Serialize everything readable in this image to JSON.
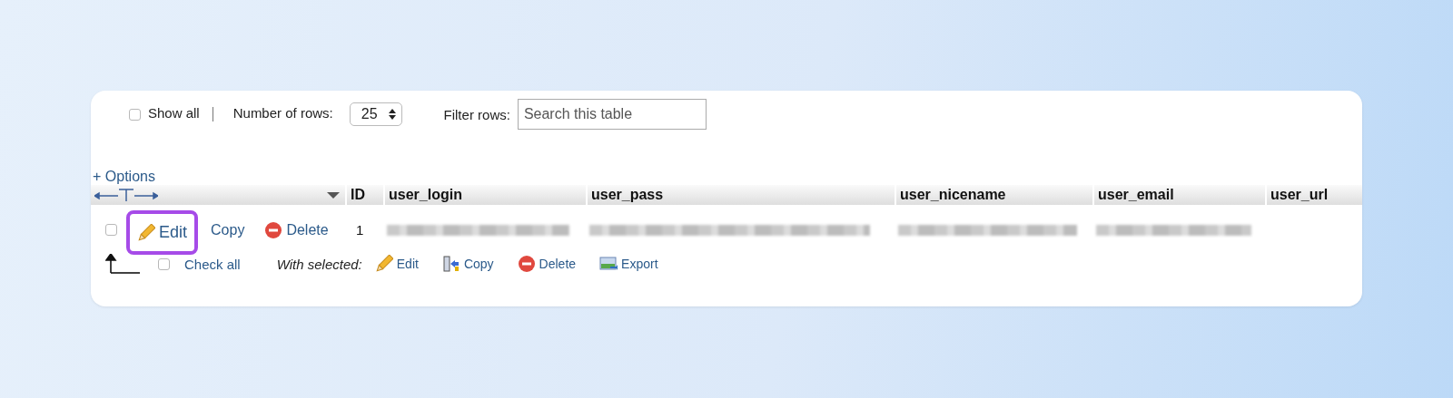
{
  "toolbar": {
    "show_all": {
      "label": "Show all",
      "checked": false
    },
    "rows": {
      "label": "Number of rows:",
      "value": "25"
    },
    "filter": {
      "label": "Filter rows:",
      "placeholder": "Search this table"
    }
  },
  "options_link": "+ Options",
  "table": {
    "columns": [
      {
        "label": "ID"
      },
      {
        "label": "user_login"
      },
      {
        "label": "user_pass"
      },
      {
        "label": "user_nicename"
      },
      {
        "label": "user_email"
      },
      {
        "label": "user_url"
      }
    ],
    "rows": [
      {
        "checked": false,
        "actions": [
          {
            "kind": "edit",
            "label": "Edit",
            "highlighted": true
          },
          {
            "kind": "copy",
            "label": "Copy",
            "highlighted": false
          },
          {
            "kind": "delete",
            "label": "Delete",
            "highlighted": false
          }
        ],
        "cells": [
          {
            "kind": "text",
            "text": "1"
          },
          {
            "kind": "redacted"
          },
          {
            "kind": "redacted"
          },
          {
            "kind": "redacted"
          },
          {
            "kind": "redacted"
          },
          {
            "kind": "blank"
          }
        ]
      }
    ]
  },
  "footer": {
    "check_all": {
      "label": "Check all",
      "checked": false
    },
    "with_selected": "With selected:",
    "actions": [
      {
        "kind": "edit",
        "label": "Edit"
      },
      {
        "kind": "copy",
        "label": "Copy"
      },
      {
        "kind": "delete",
        "label": "Delete"
      },
      {
        "kind": "export",
        "label": "Export"
      }
    ]
  }
}
